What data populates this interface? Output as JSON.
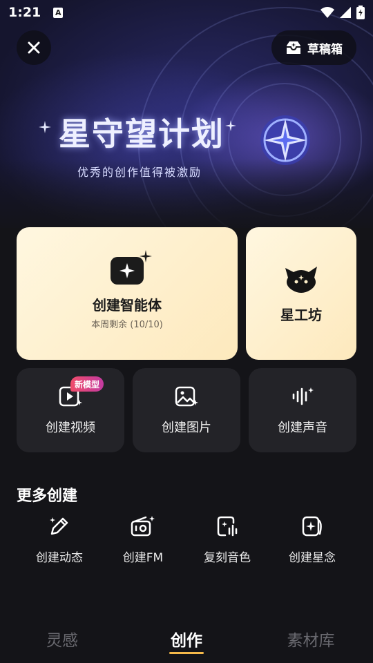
{
  "status_bar": {
    "time": "1:21",
    "a_badge": "A"
  },
  "top": {
    "draft_label": "草稿箱"
  },
  "banner": {
    "title": "星守望计划",
    "subtitle": "优秀的创作值得被激励"
  },
  "cards": {
    "agent": {
      "title": "创建智能体",
      "subtitle": "本周剩余 (10/10)"
    },
    "workshop": {
      "title": "星工坊"
    },
    "video": {
      "label": "创建视频",
      "badge": "新模型"
    },
    "image": {
      "label": "创建图片"
    },
    "voice": {
      "label": "创建声音"
    }
  },
  "more": {
    "title": "更多创建",
    "items": [
      {
        "label": "创建动态",
        "icon": "pencil-sparkle-icon"
      },
      {
        "label": "创建FM",
        "icon": "radio-icon"
      },
      {
        "label": "复刻音色",
        "icon": "voice-clone-icon"
      },
      {
        "label": "创建星念",
        "icon": "star-card-icon"
      }
    ]
  },
  "tabs": [
    {
      "label": "灵感",
      "active": false
    },
    {
      "label": "创作",
      "active": true
    },
    {
      "label": "素材库",
      "active": false
    }
  ],
  "colors": {
    "accent": "#f5b94a",
    "card_big": "#fdefc9",
    "card_small": "#232328",
    "badge": "#e0457f"
  }
}
